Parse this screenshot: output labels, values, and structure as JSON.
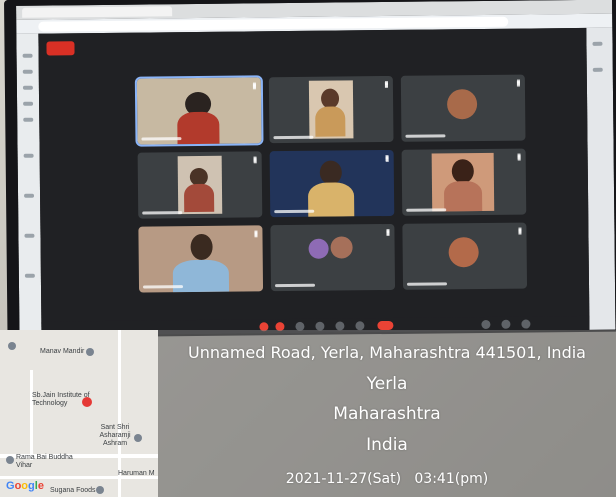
{
  "geo": {
    "address": "Unnamed Road, Yerla, Maharashtra 441501, India",
    "locality": "Yerla",
    "state": "Maharashtra",
    "country": "India",
    "timestamp": "2021-11-27(Sat)   03:41(pm)"
  },
  "map": {
    "places": [
      "Manav Mandir",
      "Sb.Jain Institute of Technology",
      "Sant Shri Asharamji Ashram",
      "Rama Bai Buddha Vihar",
      "Haruman M",
      "Sugana Foods"
    ],
    "logo": [
      "G",
      "o",
      "o",
      "g",
      "l",
      "e"
    ]
  },
  "colors": {
    "record": "#d93025",
    "active_tile": "#8ab4f8",
    "end_call": "#ea4335",
    "pin": "#e53935"
  }
}
